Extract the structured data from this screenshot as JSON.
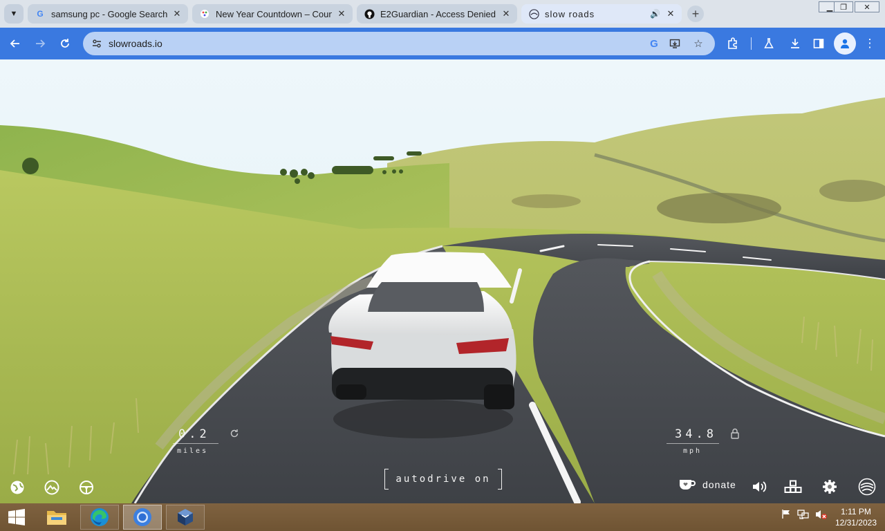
{
  "browser": {
    "tabs": [
      {
        "title": "samsung pc - Google Search",
        "favicon": "google-g-icon",
        "close": "✕"
      },
      {
        "title": "New Year Countdown – Count",
        "favicon": "countdown-icon",
        "close": "✕"
      },
      {
        "title": "E2Guardian - Access Denied",
        "favicon": "github-icon",
        "close": "✕"
      },
      {
        "title": "slow roads",
        "favicon": "slowroads-icon",
        "audio": "🔊",
        "close": "✕",
        "active": true
      }
    ],
    "new_tab": "+",
    "window_controls": {
      "minimize": "▁",
      "restore": "❐",
      "close": "✕"
    },
    "address": {
      "url": "slowroads.io"
    }
  },
  "hud": {
    "distance": {
      "value": "0.2",
      "unit": "miles"
    },
    "speed": {
      "value": "34.8",
      "unit": "mph"
    },
    "autodrive_label": "autodrive on",
    "donate_label": "donate"
  },
  "taskbar": {
    "time": "1:11 PM",
    "date": "12/31/2023"
  },
  "colors": {
    "toolbar": "#3a79e0",
    "tabstrip": "#dde3ea",
    "sky": "#eef6fa",
    "grass": "#b6c65c",
    "road": "#4a4d52",
    "taskbar": "#7a5e3a"
  }
}
